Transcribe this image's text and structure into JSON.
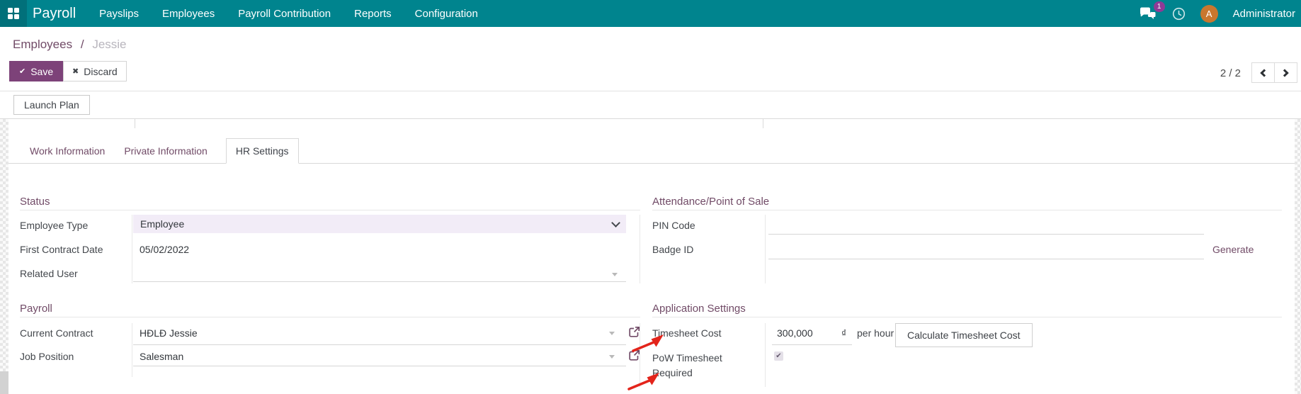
{
  "colors": {
    "topbar_bg": "#00848e",
    "topbar_icon_bg": "#01707a",
    "primary_button": "#7d4279",
    "plum_accent": "#714B67",
    "select_bg": "#f2ecf7",
    "avatar_bg": "#c9772e",
    "badge_bg": "#8f3a96",
    "annotation_arrow": "#e3241b"
  },
  "topbar": {
    "app_name": "Payroll",
    "menu": [
      "Payslips",
      "Employees",
      "Payroll Contribution",
      "Reports",
      "Configuration"
    ],
    "messages_badge": "1",
    "user": {
      "initial": "A",
      "name": "Administrator"
    }
  },
  "breadcrumb": {
    "parent": "Employees",
    "separator": "/",
    "current": "Jessie"
  },
  "control_panel": {
    "save_icon": "✔",
    "save_label": "Save",
    "discard_icon": "✖",
    "discard_label": "Discard",
    "pager_text": "2 / 2"
  },
  "launch_plan_label": "Launch Plan",
  "tabs": [
    {
      "label": "Work Information",
      "active": false
    },
    {
      "label": "Private Information",
      "active": false
    },
    {
      "label": "HR Settings",
      "active": true
    }
  ],
  "form": {
    "status": {
      "title": "Status",
      "employee_type": {
        "label": "Employee Type",
        "value": "Employee"
      },
      "first_contract_date": {
        "label": "First Contract Date",
        "value": "05/02/2022"
      },
      "related_user": {
        "label": "Related User",
        "value": ""
      }
    },
    "payroll": {
      "title": "Payroll",
      "current_contract": {
        "label": "Current Contract",
        "value": "HĐLĐ Jessie"
      },
      "job_position": {
        "label": "Job Position",
        "value": "Salesman"
      }
    },
    "attendance": {
      "title": "Attendance/Point of Sale",
      "pin_code": {
        "label": "PIN Code",
        "value": ""
      },
      "badge_id": {
        "label": "Badge ID",
        "value": "",
        "action": "Generate"
      }
    },
    "application_settings": {
      "title": "Application Settings",
      "timesheet_cost": {
        "label": "Timesheet Cost",
        "value": "300,000",
        "currency": "₫",
        "suffix": "per hour",
        "button": "Calculate Timesheet Cost"
      },
      "pow_timesheet_required": {
        "label": "PoW Timesheet Required",
        "checked": true,
        "check_icon": "✔"
      }
    }
  }
}
